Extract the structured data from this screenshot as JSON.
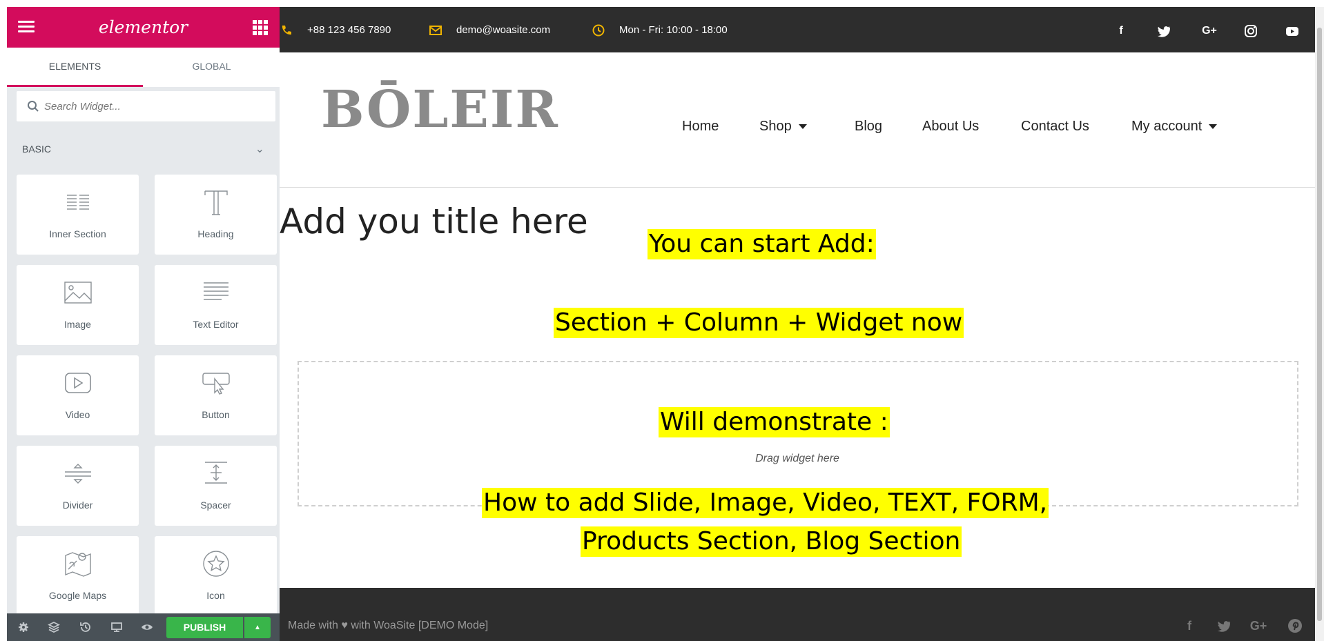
{
  "sidebar": {
    "logo": "elementor",
    "tabs": [
      "ELEMENTS",
      "GLOBAL"
    ],
    "search_placeholder": "Search Widget...",
    "category": "BASIC",
    "widgets": [
      {
        "label": "Inner Section",
        "icon": "inner-section-icon"
      },
      {
        "label": "Heading",
        "icon": "heading-icon"
      },
      {
        "label": "Image",
        "icon": "image-icon"
      },
      {
        "label": "Text Editor",
        "icon": "text-editor-icon"
      },
      {
        "label": "Video",
        "icon": "video-icon"
      },
      {
        "label": "Button",
        "icon": "button-icon"
      },
      {
        "label": "Divider",
        "icon": "divider-icon"
      },
      {
        "label": "Spacer",
        "icon": "spacer-icon"
      },
      {
        "label": "Google Maps",
        "icon": "google-maps-icon"
      },
      {
        "label": "Icon",
        "icon": "star-icon"
      }
    ],
    "footer": {
      "publish_label": "PUBLISH",
      "icons": [
        "settings-icon",
        "navigator-icon",
        "history-icon",
        "responsive-icon",
        "preview-icon"
      ]
    }
  },
  "preview": {
    "topbar": {
      "phone": "+88 123 456 7890",
      "email": "demo@woasite.com",
      "hours": "Mon - Fri: 10:00 - 18:00",
      "social": [
        "facebook-icon",
        "twitter-icon",
        "google-plus-icon",
        "instagram-icon",
        "youtube-icon"
      ]
    },
    "logo": "BŌLEIR",
    "nav": [
      "Home",
      "Shop",
      "Blog",
      "About Us",
      "Contact Us",
      "My account"
    ],
    "page_title": "Add you title here",
    "dropzone_label": "Drag widget here",
    "annotations": [
      "You can start Add:",
      "Section + Column + Widget now",
      "Will demonstrate :",
      "How to add Slide, Image, Video, TEXT, FORM,",
      "Products Section, Blog Section"
    ],
    "footer": {
      "text": "Made with ♥ with WoaSite [DEMO Mode]",
      "social": [
        "facebook-icon",
        "twitter-icon",
        "google-plus-icon",
        "pinterest-icon"
      ]
    }
  },
  "colors": {
    "brand": "#d30c5c",
    "publish": "#39b54a",
    "dark_bar": "#2d2d2d",
    "highlight": "#ffff00",
    "topbar_icon": "#f0b400"
  }
}
